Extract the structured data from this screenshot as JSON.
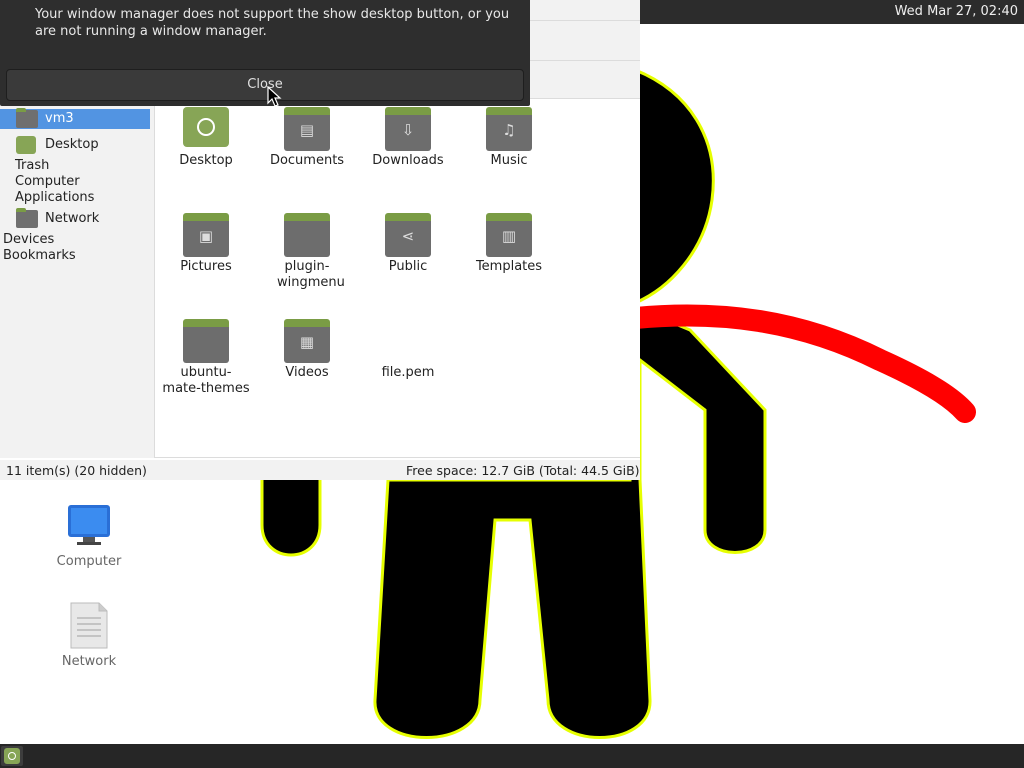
{
  "top_panel": {
    "clock": "Wed Mar 27, 02:40"
  },
  "desktop": {
    "icons": [
      {
        "label": "Computer",
        "icon": "monitor-icon"
      },
      {
        "label": "Network",
        "icon": "document-icon"
      }
    ]
  },
  "dialog": {
    "message": "Your window manager does not support the show desktop button, or you are not running a window manager.",
    "close_label": "Close"
  },
  "file_manager": {
    "sidebar": {
      "items": [
        {
          "label": "vm3",
          "selected": true,
          "icon": "folder-icon"
        },
        {
          "label": "Desktop",
          "icon": "desktop-icon"
        },
        {
          "label": "Trash"
        },
        {
          "label": "Computer"
        },
        {
          "label": "Applications"
        },
        {
          "label": "Network",
          "icon": "folder-icon"
        }
      ],
      "sections": [
        "Devices",
        "Bookmarks"
      ]
    },
    "items": [
      {
        "label": "Desktop",
        "icon": "desktop-icon"
      },
      {
        "label": "Documents",
        "icon": "documents-icon"
      },
      {
        "label": "Downloads",
        "icon": "download-icon"
      },
      {
        "label": "Music",
        "icon": "music-icon"
      },
      {
        "label": "Pictures",
        "icon": "pictures-icon"
      },
      {
        "label": "plugin-wingmenu",
        "icon": "folder-icon"
      },
      {
        "label": "Public",
        "icon": "share-icon"
      },
      {
        "label": "Templates",
        "icon": "templates-icon"
      },
      {
        "label": "ubuntu-mate-themes",
        "icon": "folder-icon"
      },
      {
        "label": "Videos",
        "icon": "videos-icon"
      },
      {
        "label": "file.pem",
        "icon": "file-icon"
      }
    ],
    "status": {
      "item_count": "11 item(s) (20 hidden)",
      "free_space": "Free space: 12.7 GiB (Total: 44.5 GiB)"
    }
  },
  "colors": {
    "panel": "#2c2c2c",
    "selection": "#5294e2",
    "folder_tab": "#7a9c45",
    "figure_outline": "#e6ff00",
    "figure_arm": "#ff0000"
  }
}
